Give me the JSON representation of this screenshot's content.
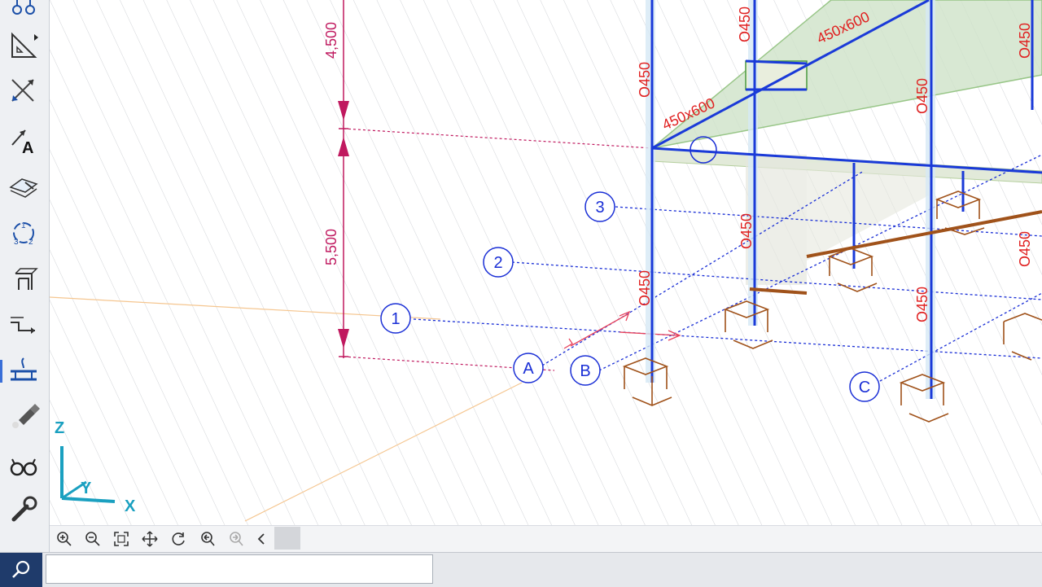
{
  "toolbar": {
    "tools": [
      {
        "name": "grid-tool",
        "icon": "grid-icon"
      },
      {
        "name": "dimension-tool",
        "icon": "ruler-triangle-icon"
      },
      {
        "name": "intersect-tool",
        "icon": "cross-arrow-icon"
      },
      {
        "name": "text-tool",
        "icon": "text-a-icon"
      },
      {
        "name": "slab-tool",
        "icon": "slab-edit-icon"
      },
      {
        "name": "numbering-tool",
        "icon": "renumber-icon"
      },
      {
        "name": "section-tool",
        "icon": "section-icon"
      },
      {
        "name": "offset-tool",
        "icon": "offset-icon"
      },
      {
        "name": "support-tool",
        "icon": "support-icon"
      },
      {
        "name": "flashlight-tool",
        "icon": "flashlight-icon"
      },
      {
        "name": "glasses-tool",
        "icon": "glasses-icon"
      },
      {
        "name": "settings-tool",
        "icon": "wrench-icon"
      }
    ]
  },
  "axes": {
    "x": "X",
    "y": "Y",
    "z": "Z"
  },
  "dimensions": {
    "upper": "4,500",
    "lower": "5,500"
  },
  "grid_markers": {
    "row1": "1",
    "row2": "2",
    "row3": "3",
    "colA": "A",
    "colB": "B",
    "colC": "C"
  },
  "column_labels": {
    "c1": "O450",
    "c2": "O450",
    "c3": "O450",
    "c4": "O450",
    "c5": "O450",
    "c6": "O450",
    "c7": "O450",
    "c8": "O450",
    "c9": "O450"
  },
  "beam_labels": {
    "b1": "450x600",
    "b2": "450x600"
  },
  "colors": {
    "grid_blue": "#1a2fd6",
    "dimension_magenta": "#c0195f",
    "column_red": "#e02020",
    "foundation_brown": "#a0521a",
    "slab_green": "#cfe3c9"
  },
  "navbar": {
    "buttons": [
      "zoom-in-icon",
      "zoom-out-icon",
      "zoom-extents-icon",
      "pan-icon",
      "rotate-icon",
      "zoom-previous-icon",
      "zoom-next-icon",
      "scroll-left-icon"
    ]
  },
  "command": {
    "input_value": "",
    "placeholder": ""
  }
}
